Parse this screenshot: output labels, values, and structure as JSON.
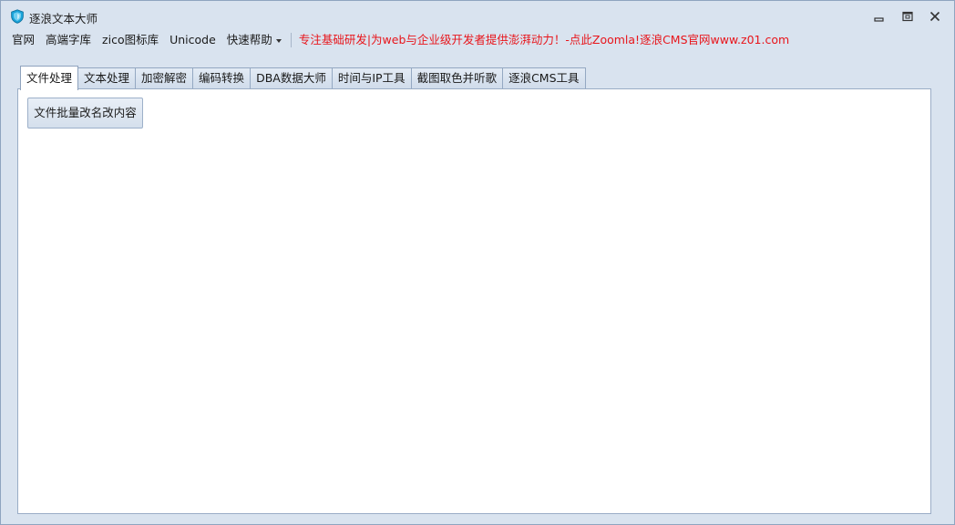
{
  "window": {
    "title": "逐浪文本大师",
    "icon": "shield-icon",
    "controls": [
      "minimize-icon",
      "maximize-icon",
      "close-icon"
    ]
  },
  "menu": {
    "items": [
      {
        "label": "官网"
      },
      {
        "label": "高端字库"
      },
      {
        "label": "zico图标库"
      },
      {
        "label": "Unicode"
      },
      {
        "label": "快速帮助",
        "dropdown": true
      }
    ],
    "slogan": "专注基础研发|为web与企业级开发者提供澎湃动力！-点此Zoomla!逐浪CMS官网www.z01.com",
    "slogan_color": "#e8151b"
  },
  "tabs": [
    {
      "label": "文件处理",
      "active": true
    },
    {
      "label": "文本处理"
    },
    {
      "label": "加密解密"
    },
    {
      "label": "编码转换"
    },
    {
      "label": "DBA数据大师"
    },
    {
      "label": "时间与IP工具"
    },
    {
      "label": "截图取色并听歌"
    },
    {
      "label": "逐浪CMS工具"
    }
  ],
  "content": {
    "actions": [
      {
        "label": "文件批量改名改内容"
      }
    ]
  },
  "colors": {
    "window_bg": "#d9e3ef",
    "tab_border": "#94a8c2",
    "panel_bg": "#ffffff",
    "icon_accent": "#1aa3d9"
  }
}
